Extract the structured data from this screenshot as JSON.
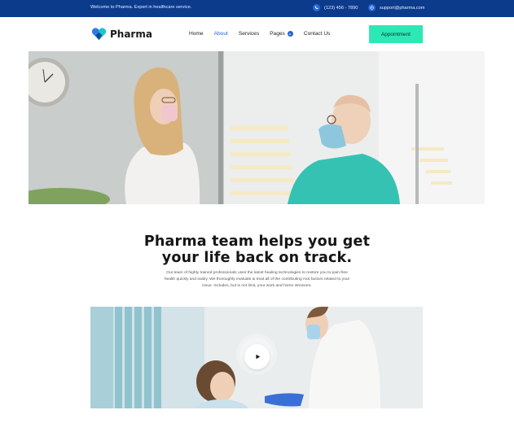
{
  "topbar": {
    "welcome": "Welcome to Pharma. Expert in healthcare service.",
    "phone": "(123) 456 - 7890",
    "email": "support@pharma.com",
    "phone_icon": "phone-icon",
    "email_icon": "at-icon"
  },
  "header": {
    "brand": "Pharma",
    "logo_icon": "heart-logo-icon",
    "nav": {
      "home": "Home",
      "about": "About",
      "services": "Services",
      "pages": "Pages",
      "contact": "Contact Us"
    },
    "appointment": "Appointment"
  },
  "hero": {
    "image": "hero-photo"
  },
  "intro": {
    "headline_line1": "Pharma team helps you get",
    "headline_line2": "your life back on track.",
    "description_line1": "Our team of highly trained professionals uses the latest healing technologies to restore you to pain-free",
    "description_line2": "health quickly and easily. We thoroughly evaluate & treat all of the contributing root factors related to your",
    "description_line3": "issue. Includes, but is not limit, your work and home stressors."
  },
  "video": {
    "play_icon": "play-icon"
  },
  "colors": {
    "topbar": "#0d3b8c",
    "accent_blue": "#1e63d6",
    "button_green": "#2ee8b4"
  }
}
